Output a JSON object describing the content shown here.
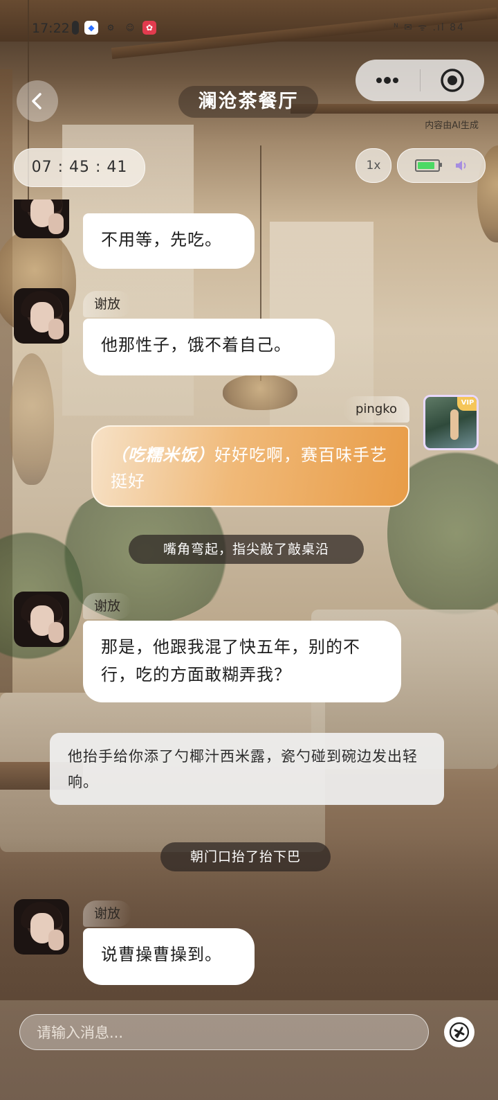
{
  "status_bar": {
    "time": "17:22",
    "right_icons": "ᴺ ✉ ᯤ .ıl 84"
  },
  "header": {
    "title": "澜沧茶餐厅",
    "ai_note": "内容由AI生成",
    "timer": "07 : 45 : 41",
    "speed": "1x"
  },
  "messages": {
    "m1": {
      "text": "不用等，先吃。"
    },
    "m2": {
      "sender": "谢放",
      "text": "他那性子，饿不着自己。"
    },
    "m3": {
      "sender": "pingko",
      "action": "（吃糯米饭）",
      "text": "好好吃啊，赛百味手艺挺好"
    },
    "a1": {
      "text": "嘴角弯起，指尖敲了敲桌沿"
    },
    "m4": {
      "sender": "谢放",
      "text": "那是，他跟我混了快五年，别的不行，吃的方面敢糊弄我？"
    },
    "n1": {
      "text": "他抬手给你添了勺椰汁西米露，瓷勺碰到碗边发出轻响。"
    },
    "a2": {
      "text": "朝门口抬了抬下巴"
    },
    "m5": {
      "sender": "谢放",
      "text": "说曹操曹操到。"
    }
  },
  "input": {
    "placeholder": "请输入消息..."
  },
  "user_badge": "VIP",
  "battery_level": 0.85,
  "colors": {
    "user_bubble_from": "#f6e1c6",
    "user_bubble_to": "#e89c47",
    "battery": "#4cd964",
    "action_pill": "#2d2622"
  }
}
